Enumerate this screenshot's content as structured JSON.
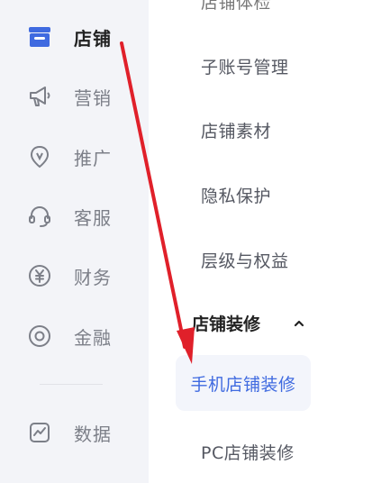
{
  "left_nav": {
    "items": [
      {
        "label": "店铺",
        "icon": "store-icon",
        "active": true
      },
      {
        "label": "营销",
        "icon": "megaphone-icon"
      },
      {
        "label": "推广",
        "icon": "location-pin-icon"
      },
      {
        "label": "客服",
        "icon": "headset-icon"
      },
      {
        "label": "财务",
        "icon": "yen-coin-icon"
      },
      {
        "label": "金融",
        "icon": "target-circle-icon"
      },
      {
        "label": "数据",
        "icon": "chart-icon"
      }
    ]
  },
  "sub_menu": {
    "clipped_top": "店铺体检",
    "items": [
      "子账号管理",
      "店铺素材",
      "隐私保护",
      "层级与权益"
    ],
    "section": {
      "label": "店铺装修",
      "expanded_icon": "chevron-up-icon",
      "children": [
        "手机店铺装修",
        "PC店铺装修"
      ],
      "selected_index": 0
    }
  },
  "colors": {
    "nav_bg": "#f3f4f8",
    "selected_text": "#3f6ae0",
    "selected_bg": "#f3f5fb",
    "icon_active": "#3f6ae0",
    "annotation_arrow": "#e0202a"
  }
}
